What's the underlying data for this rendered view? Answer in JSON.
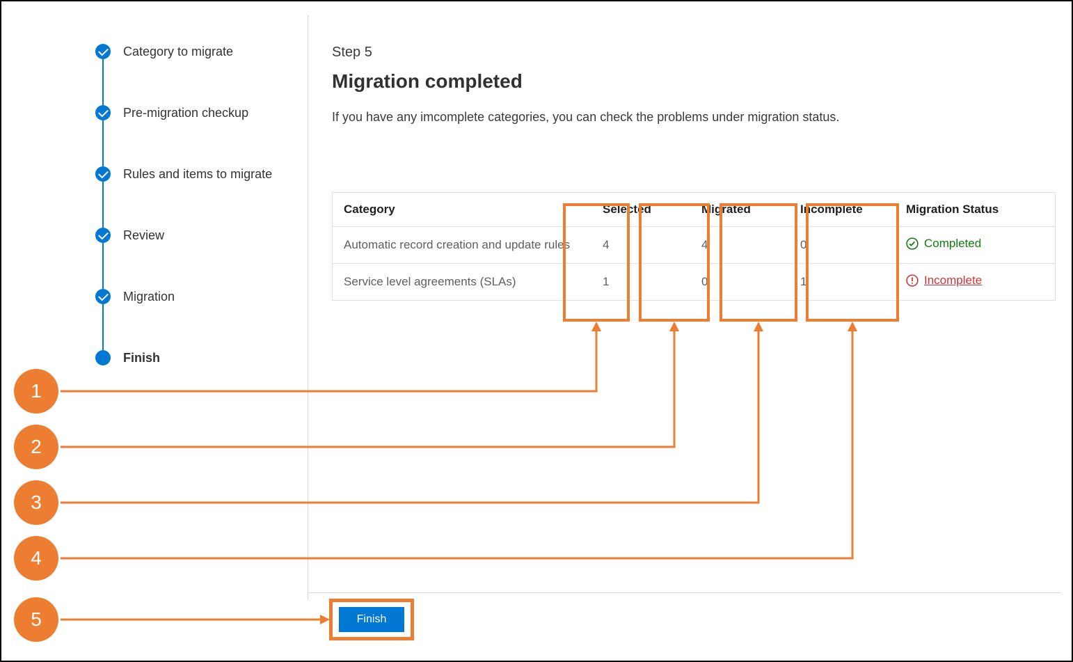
{
  "stepper": {
    "items": [
      {
        "label": "Category to migrate",
        "state": "done"
      },
      {
        "label": "Pre-migration checkup",
        "state": "done"
      },
      {
        "label": "Rules and items to migrate",
        "state": "done"
      },
      {
        "label": "Review",
        "state": "done"
      },
      {
        "label": "Migration",
        "state": "done"
      },
      {
        "label": "Finish",
        "state": "current"
      }
    ]
  },
  "main": {
    "step_label": "Step 5",
    "title": "Migration completed",
    "subtitle": "If you have any imcomplete categories, you can check the problems under migration status."
  },
  "table": {
    "headers": {
      "category": "Category",
      "selected": "Selected",
      "migrated": "Migrated",
      "incomplete": "Incomplete",
      "status": "Migration Status"
    },
    "rows": [
      {
        "category": "Automatic record creation and update rules",
        "selected": "4",
        "migrated": "4",
        "incomplete": "0",
        "status": "Completed",
        "status_kind": "completed"
      },
      {
        "category": "Service level agreements (SLAs)",
        "selected": "1",
        "migrated": "0",
        "incomplete": "1",
        "status": "Incomplete",
        "status_kind": "incomplete"
      }
    ]
  },
  "footer": {
    "finish_label": "Finish"
  },
  "annotations": {
    "callouts": [
      "1",
      "2",
      "3",
      "4",
      "5"
    ]
  },
  "colors": {
    "accent": "#0078d4",
    "annotation": "#ed7d31",
    "success": "#107c10",
    "error": "#d13438"
  }
}
